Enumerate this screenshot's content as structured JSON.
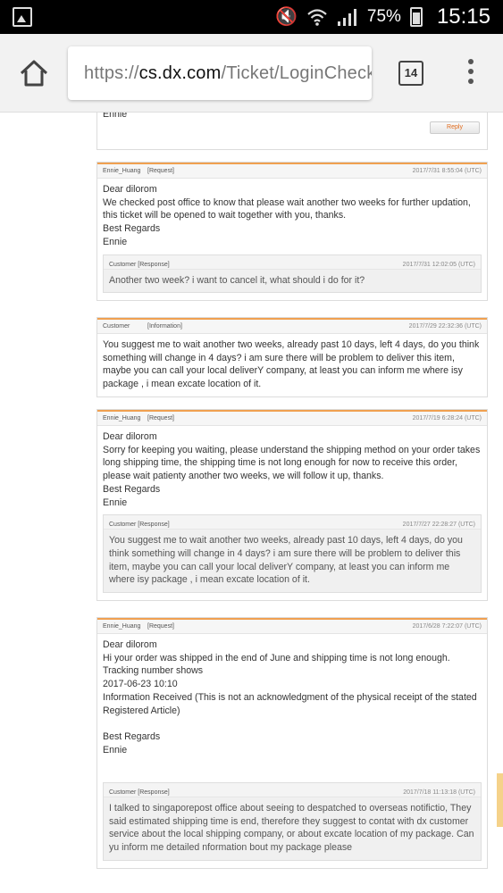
{
  "status_bar": {
    "battery_percent": "75%",
    "time": "15:15",
    "icons": [
      "gallery-icon",
      "mute-icon",
      "wifi-icon",
      "signal-icon",
      "battery-icon"
    ]
  },
  "browser": {
    "url_prefix": "https://",
    "url_domain": "cs.dx.com",
    "url_path": "/Ticket/LoginCheckI",
    "tab_count": "14"
  },
  "messages": [
    {
      "body": "Ennie",
      "reply_label": "Reply"
    },
    {
      "author": "Ennie_Huang",
      "role": "[Request]",
      "timestamp": "2017/7/31 8:55:04 (UTC)",
      "body": "Dear dilorom\nWe checked post office to know that please wait another two weeks for further updation, this ticket will be opened to wait together with you, thanks.\nBest Regards\nEnnie",
      "sub": {
        "author": "Customer [Response]",
        "timestamp": "2017/7/31 12:02:05 (UTC)",
        "body": "Another two week? i want to cancel it, what should i do for it?"
      }
    },
    {
      "author": "Customer",
      "role": "[Information]",
      "timestamp": "2017/7/29 22:32:36 (UTC)",
      "body": "You suggest me to wait another two weeks, already past 10 days, left 4 days, do you think something will change in 4 days? i am sure there will be problem to deliver this item, maybe you can call your local deliverY company, at least you can inform me where isy package , i mean excate location of it."
    },
    {
      "author": "Ennie_Huang",
      "role": "[Request]",
      "timestamp": "2017/7/19 6:28:24 (UTC)",
      "body": "Dear dilorom\nSorry for keeping you waiting, please understand the shipping method on your order takes long shipping time, the shipping time is not long enough for now to receive this order, please wait patienty another two weeks, we will follow it up, thanks.\nBest Regards\nEnnie",
      "sub": {
        "author": "Customer [Response]",
        "timestamp": "2017/7/27 22:28:27 (UTC)",
        "body": "You suggest me to wait another two weeks, already past 10 days, left 4 days, do you think something will change in 4 days? i am sure there will be problem to deliver this item, maybe you can call your local deliverY company, at least you can inform me where isy package , i mean excate location of it."
      }
    },
    {
      "author": "Ennie_Huang",
      "role": "[Request]",
      "timestamp": "2017/6/28 7:22:07 (UTC)",
      "body": "Dear dilorom\nHi your order was shipped in the end of June and shipping time is not long enough.\nTracking number shows\n2017-06-23 10:10\nInformation Received (This is not an acknowledgment of the physical receipt of the stated Registered Article)\n\nBest Regards\nEnnie\n\n",
      "sub": {
        "author": "Customer [Response]",
        "timestamp": "2017/7/18 11:13:18 (UTC)",
        "body": "I talked to singaporepost office about seeing to despatched to overseas notifictio, They said estimated shipping time is end, therefore they suggest to contat with dx customer service about the local shipping company, or about excate location of my package. Can yu inform me detailed nformation bout my package please"
      }
    }
  ]
}
